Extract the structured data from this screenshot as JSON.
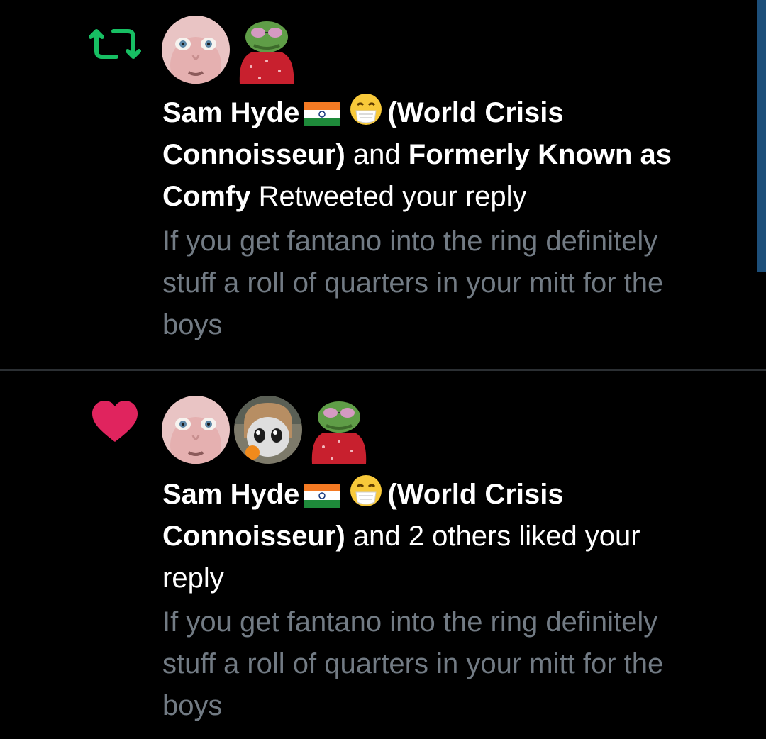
{
  "notifications": [
    {
      "type": "retweet",
      "icon": "retweet-icon",
      "icon_color": "#17bf63",
      "avatars": [
        "face-avatar",
        "pepe-avatar"
      ],
      "actor_primary": "Sam Hyde",
      "actor_primary_suffix": "(World Crisis",
      "actor_primary_suffix2": "Connoisseur)",
      "connector": "and",
      "actor_secondary": "Formerly Known as",
      "actor_secondary2": "Comfy",
      "action_text": "Retweeted your reply",
      "tweet_line1": "If you get fantano into the ring definitely",
      "tweet_line2": "stuff a roll of quarters in your mitt for the",
      "tweet_line3": "boys"
    },
    {
      "type": "like",
      "icon": "heart-icon",
      "icon_color": "#e0245e",
      "avatars": [
        "face-avatar",
        "anime-avatar",
        "pepe-avatar"
      ],
      "actor_primary": "Sam Hyde",
      "actor_primary_suffix": "(World Crisis",
      "actor_primary_suffix2": "Connoisseur)",
      "action_text": "and 2 others liked your",
      "action_text2": "reply",
      "tweet_line1": "If you get fantano into the ring definitely",
      "tweet_line2": "stuff a roll of quarters in your mitt for the",
      "tweet_line3": "boys"
    }
  ],
  "colors": {
    "background": "#000000",
    "text_primary": "#ffffff",
    "text_secondary": "#727b84",
    "divider": "#2b2f33",
    "scrollbar": "#1d4f7a"
  }
}
